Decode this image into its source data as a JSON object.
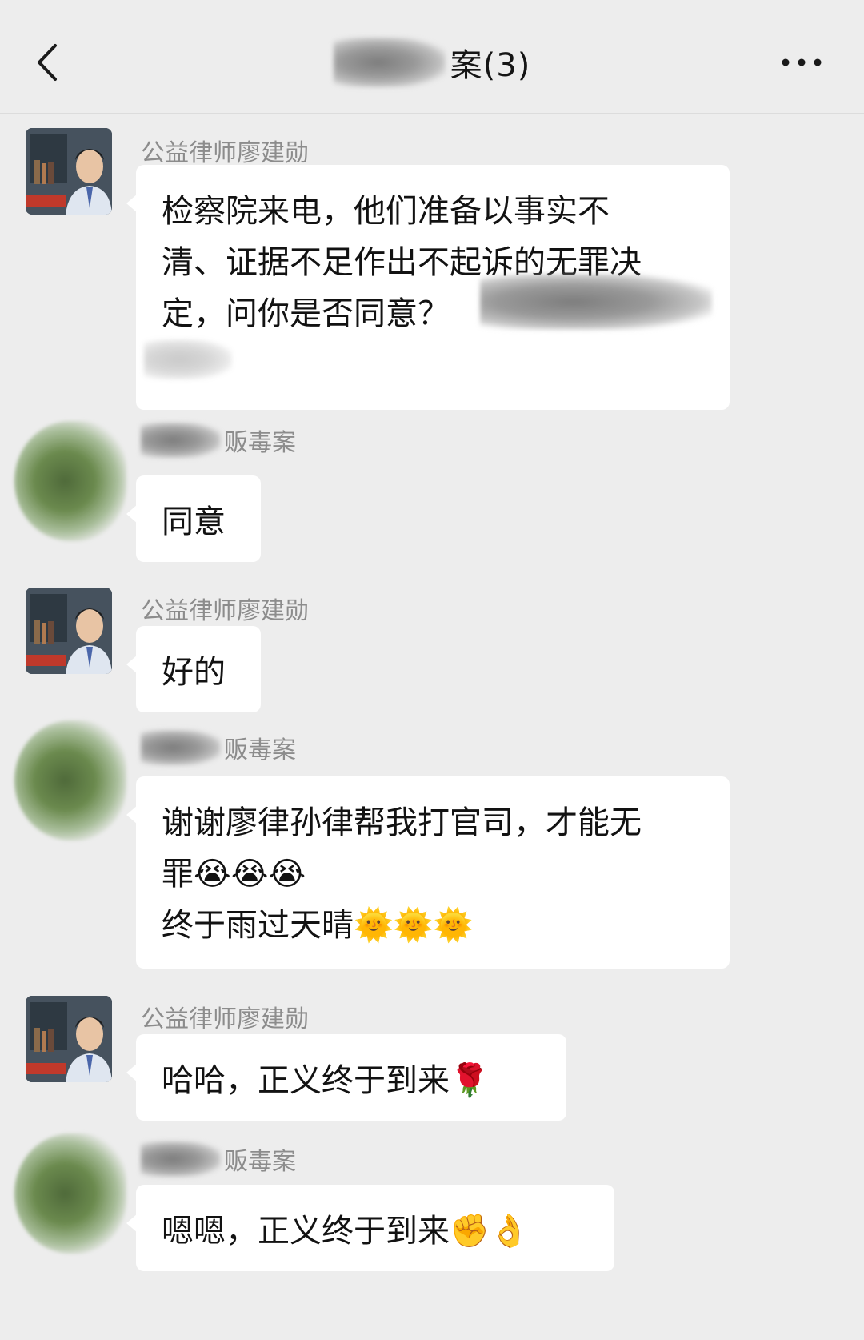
{
  "header": {
    "title": "案(3)",
    "back_icon": "chevron-left-icon",
    "more_icon": "more-dots-icon"
  },
  "messages": [
    {
      "sender": "公益律师廖建勋",
      "avatar": "lawyer-avatar",
      "lines": [
        "检察院来电，他们准备以事实不",
        "清、证据不足作出不起诉的无罪决",
        "定，问你是否同意？"
      ]
    },
    {
      "sender": "贩毒案",
      "avatar": "client-avatar",
      "lines": [
        "同意"
      ]
    },
    {
      "sender": "公益律师廖建勋",
      "avatar": "lawyer-avatar",
      "lines": [
        "好的"
      ]
    },
    {
      "sender": "贩毒案",
      "avatar": "client-avatar",
      "lines": [
        "谢谢廖律孙律帮我打官司，才能无",
        "罪😭😭😭",
        "终于雨过天晴🌞🌞🌞"
      ]
    },
    {
      "sender": "公益律师廖建勋",
      "avatar": "lawyer-avatar",
      "lines": [
        "哈哈，正义终于到来🌹"
      ]
    },
    {
      "sender": "贩毒案",
      "avatar": "client-avatar",
      "lines": [
        "嗯嗯，正义终于到来✊👌"
      ]
    }
  ]
}
